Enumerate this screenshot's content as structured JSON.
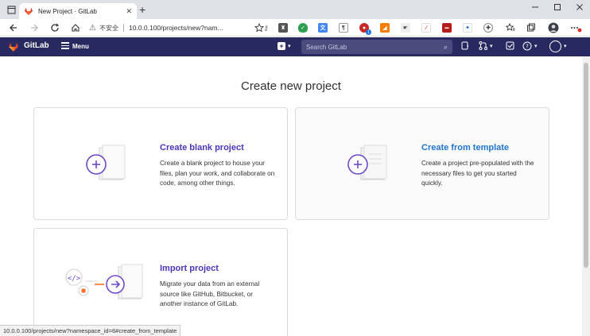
{
  "browser": {
    "tab_title": "New Project · GitLab",
    "tab_close": "✕",
    "new_tab": "+",
    "insecure_label": "不安全",
    "url": "10.0.0.100/projects/new?nam...",
    "status_url": "10.0.0.100/projects/new?namespace_id=6#create_from_template"
  },
  "gitlab": {
    "brand": "GitLab",
    "menu_label": "Menu",
    "search_placeholder": "Search GitLab"
  },
  "page": {
    "title": "Create new project",
    "cards": [
      {
        "title": "Create blank project",
        "desc": "Create a blank project to house your files, plan your work, and collaborate on code, among other things."
      },
      {
        "title": "Create from template",
        "desc": "Create a project pre-populated with the necessary files to get you started quickly."
      },
      {
        "title": "Import project",
        "desc": "Migrate your data from an external source like GitHub, Bitbucket, or another instance of GitLab."
      }
    ]
  },
  "colors": {
    "gitlab_header": "#292961",
    "card_title_purple": "#4d35b8",
    "card_title_blue": "#1f75cb"
  }
}
